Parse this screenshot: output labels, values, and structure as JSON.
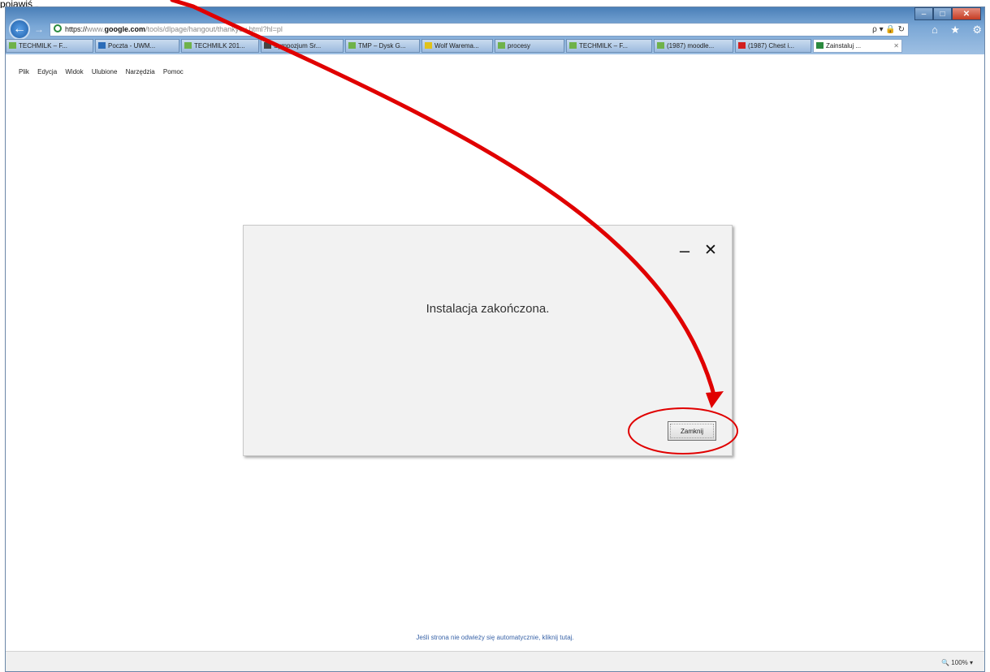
{
  "caption": "pojawiś „",
  "browser": {
    "address": {
      "protocol": "https://",
      "prefix": "www.",
      "domain": "google.com",
      "path": "/tools/dlpage/hangout/thankyou.html?hl=pl",
      "tools": "ρ ▾ 🔒 ↻"
    },
    "nav_icons": [
      "⌂",
      "★",
      "⚙"
    ],
    "window_controls": {
      "minimize": "–",
      "maximize": "□",
      "close": "✕"
    },
    "tabs": [
      {
        "label": "TECHMILK – F...",
        "icon_color": "#6fb24a"
      },
      {
        "label": "Poczta - UWM...",
        "icon_color": "#2b6cb8"
      },
      {
        "label": "TECHMILK 201...",
        "icon_color": "#6fb24a"
      },
      {
        "label": "Sympozjum Sr...",
        "icon_color": "#444444"
      },
      {
        "label": "TMP – Dysk G...",
        "icon_color": "#6fb24a"
      },
      {
        "label": "Wolf Warema...",
        "icon_color": "#e0c21a"
      },
      {
        "label": "procesy",
        "icon_color": "#6fb24a"
      },
      {
        "label": "TECHMILK – F...",
        "icon_color": "#6fb24a"
      },
      {
        "label": "(1987) moodle...",
        "icon_color": "#6fb24a"
      },
      {
        "label": "(1987) Chest i...",
        "icon_color": "#d21f1f"
      },
      {
        "label": "Zainstaluj ...",
        "icon_color": "#2b8a3e",
        "active": true
      }
    ],
    "menu": [
      "Plik",
      "Edycja",
      "Widok",
      "Ulubione",
      "Narzędzia",
      "Pomoc"
    ],
    "status": {
      "zoom": "🔍 100%  ▾"
    }
  },
  "dialog": {
    "minimize": "–",
    "close": "✕",
    "message": "Instalacja zakończona.",
    "button": "Zamknij"
  },
  "page": {
    "redirect_text": "Jeśli strona nie odwieży się automatycznie, kliknij tutaj."
  },
  "annotation": {
    "color": "#e00000"
  }
}
